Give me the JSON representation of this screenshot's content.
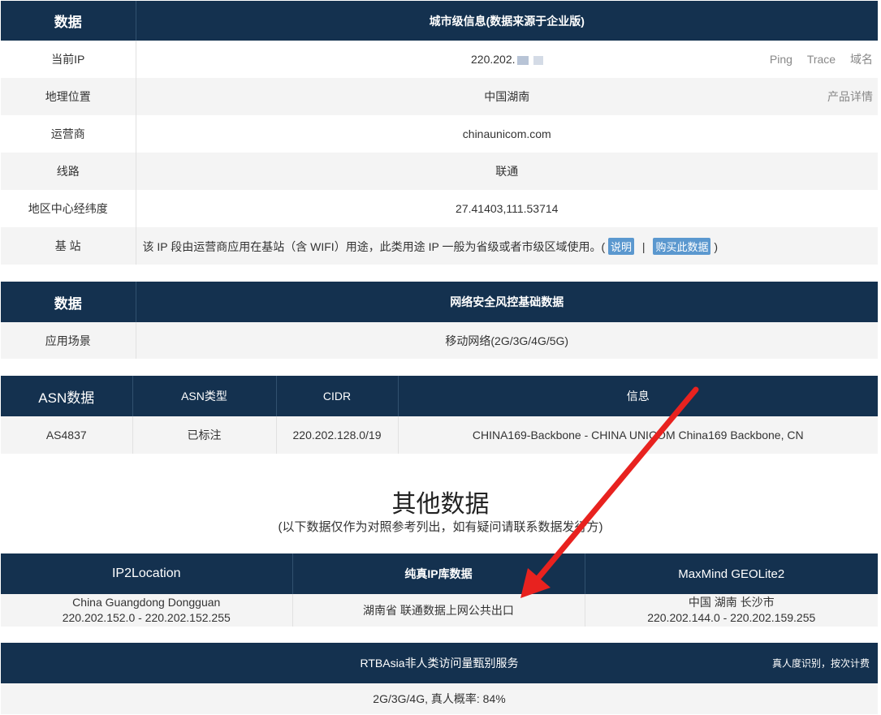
{
  "city_table": {
    "header": [
      "数据",
      "城市级信息(数据来源于企业版)"
    ],
    "ip_row": {
      "label": "当前IP",
      "value": "220.202.",
      "links": [
        "Ping",
        "Trace",
        "域名"
      ]
    },
    "geo_row": {
      "label": "地理位置",
      "value": "中国湖南",
      "link": "产品详情"
    },
    "isp_row": {
      "label": "运营商",
      "value": "chinaunicom.com"
    },
    "line_row": {
      "label": "线路",
      "value": "联通"
    },
    "coord_row": {
      "label": "地区中心经纬度",
      "value": "27.41403,111.53714"
    },
    "station_row": {
      "label": "基 站",
      "text": "该 IP 段由运营商应用在基站（含 WIFI）用途，此类用途 IP 一般为省级或者市级区域使用。(",
      "explain": "说明",
      "sep": "|",
      "buy": "购买此数据",
      "close": ")"
    }
  },
  "risk_table": {
    "header": [
      "数据",
      "网络安全风控基础数据"
    ],
    "row": {
      "label": "应用场景",
      "value": "移动网络(2G/3G/4G/5G)"
    }
  },
  "asn_table": {
    "header": [
      "ASN数据",
      "ASN类型",
      "CIDR",
      "信息"
    ],
    "row": [
      "AS4837",
      "已标注",
      "220.202.128.0/19",
      "CHINA169-Backbone - CHINA UNICOM China169 Backbone, CN"
    ]
  },
  "other": {
    "title": "其他数据",
    "subtitle": "(以下数据仅作为对照参考列出，如有疑问请联系数据发行方)"
  },
  "other_table": {
    "header": [
      "IP2Location",
      "纯真IP库数据",
      "MaxMind GEOLite2"
    ],
    "cells": [
      {
        "line1": "China Guangdong Dongguan",
        "line2": "220.202.152.0 - 220.202.152.255"
      },
      {
        "line1": "湖南省 联通数据上网公共出口",
        "line2": ""
      },
      {
        "line1": "中国 湖南 长沙市",
        "line2": "220.202.144.0 - 220.202.159.255"
      }
    ]
  },
  "rtb_table": {
    "header": "RTBAsia非人类访问量甄别服务",
    "note": "真人度识别，按次计费",
    "value": "2G/3G/4G, 真人概率: 84%"
  },
  "colors": {
    "header_bg": "#14314f",
    "row_alt": "#f4f4f4",
    "pill": "#5b98cf",
    "arrow": "#e8221f"
  }
}
